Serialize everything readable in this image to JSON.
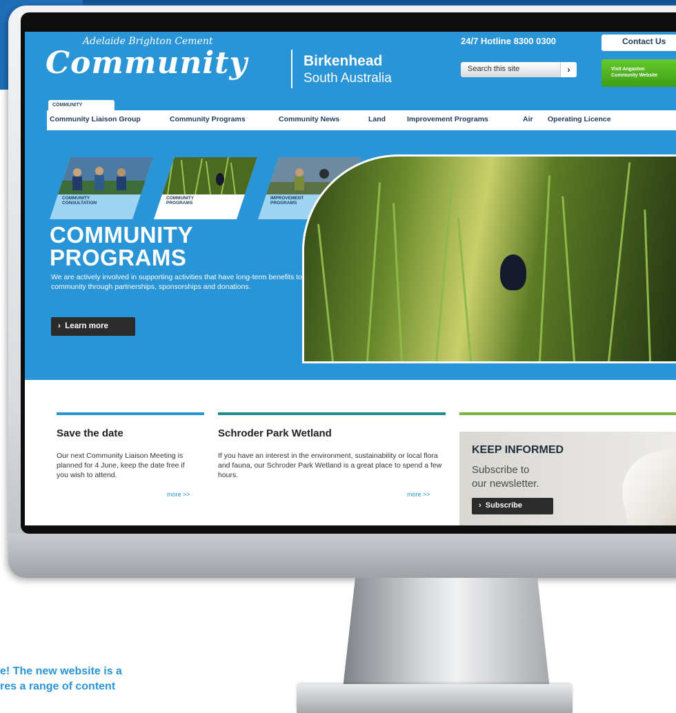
{
  "site": {
    "logo_script": "Adelaide Brighton Cement",
    "logo_main": "Community",
    "brand_line1": "Birkenhead",
    "brand_line2": "South Australia",
    "hotline": "24/7 Hotline 8300 0300",
    "contact_label": "Contact Us",
    "search_placeholder": "Search this site",
    "search_go_glyph": "›",
    "green_button_line1": "Visit Angaston",
    "green_button_line2": "Community Website"
  },
  "nav": {
    "tab_label": "COMMUNITY",
    "items": [
      "Community Liaison Group",
      "Community Programs",
      "Community News",
      "Land",
      "Improvement Programs",
      "Air",
      "Operating Licence"
    ]
  },
  "promos": [
    {
      "line1": "COMMUNITY",
      "line2": "CONSULTATION"
    },
    {
      "line1": "COMMUNITY",
      "line2": "PROGRAMS"
    },
    {
      "line1": "IMPROVEMENT",
      "line2": "PROGRAMS"
    }
  ],
  "hero": {
    "title_line1": "COMMUNITY",
    "title_line2": "PROGRAMS",
    "text": "We are actively involved in supporting activities that have long-term benefits to the community through partnerships, sponsorships and donations.",
    "button_label": "Learn more",
    "button_glyph": "›"
  },
  "sections": {
    "save_the_date": {
      "title": "Save the date",
      "text": "Our next Community Liaison Meeting is planned for 4 June, keep the date free if you wish to attend.",
      "more": "more >>"
    },
    "wetland": {
      "title": "Schroder Park Wetland",
      "text": "If you have an interest in the environment, sustainability or local flora and fauna, our Schroder Park Wetland is a great place to spend a few hours.",
      "more": "more >>"
    },
    "keep_informed": {
      "title": "KEEP INFORMED",
      "subtitle_line1": "Subscribe to",
      "subtitle_line2": "our newsletter.",
      "button_label": "Subscribe",
      "button_glyph": "›"
    }
  },
  "caption": {
    "line1": "e! The new website is a",
    "line2": "res a range of content"
  },
  "colors": {
    "site_blue": "#2a95d6",
    "nav_text": "#1d3b5c",
    "green_button": "#4fb31f",
    "dark_button": "#2b2b2b",
    "rule_blue": "#2a95d6",
    "rule_teal": "#1a8a8a",
    "rule_green": "#7ab33a",
    "caption_blue": "#2a95d6"
  },
  "icons": [
    "chevron-right-icon"
  ]
}
